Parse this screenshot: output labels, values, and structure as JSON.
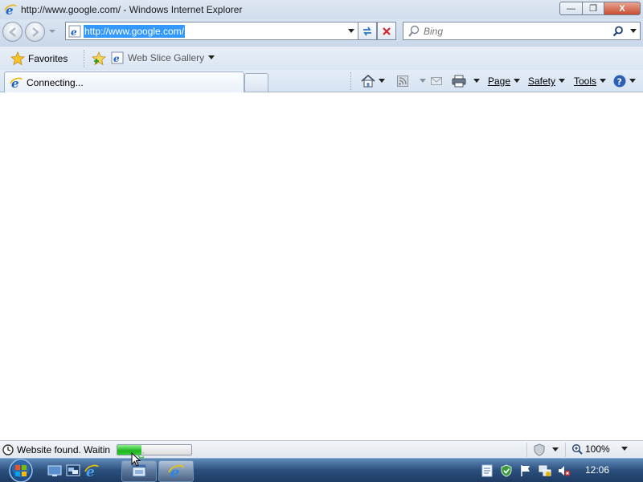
{
  "window": {
    "title": "http://www.google.com/ - Windows Internet Explorer",
    "minimize_label": "—",
    "maximize_label": "❐",
    "close_label": "X"
  },
  "address_bar": {
    "url": "http://www.google.com/"
  },
  "search": {
    "placeholder": "Bing"
  },
  "favorites_bar": {
    "favorites_label": "Favorites",
    "web_slice_gallery_label": "Web Slice Gallery"
  },
  "tab": {
    "title": "Connecting..."
  },
  "command_bar": {
    "page_label": "Page",
    "safety_label": "Safety",
    "tools_label": "Tools"
  },
  "status_bar": {
    "text": "Website found. Waitin",
    "progress_fraction": 0.33,
    "zoom_label": "100%"
  },
  "taskbar": {
    "clock": "12:06"
  },
  "colors": {
    "selection": "#3399ff",
    "progress_green": "#1fb51f"
  }
}
